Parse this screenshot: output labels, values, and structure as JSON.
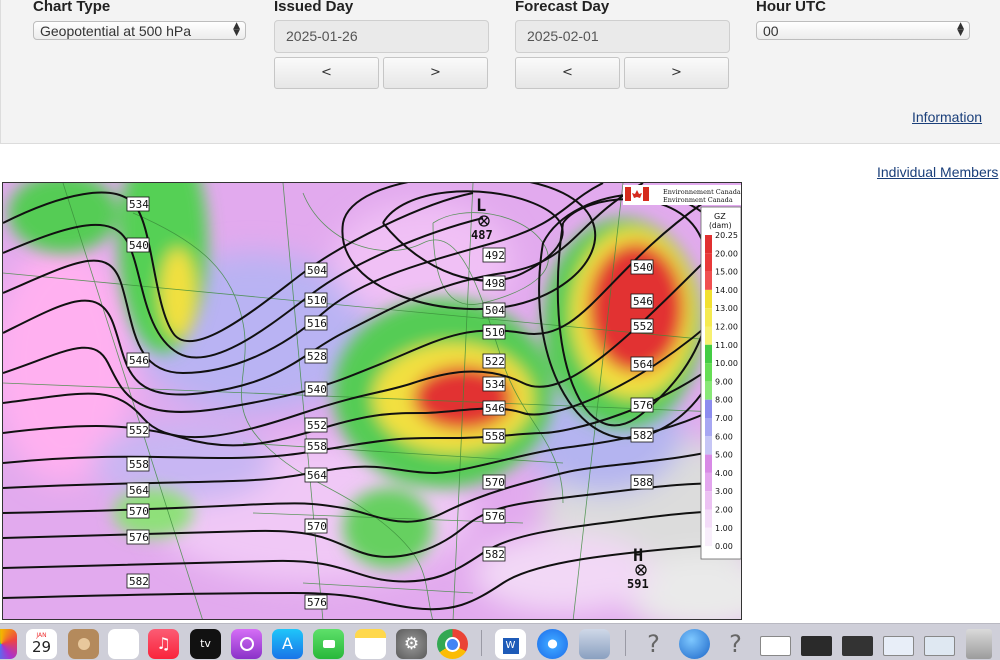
{
  "controls": {
    "chart_type_label": "Chart Type",
    "chart_type_value": "Geopotential at 500 hPa",
    "issued_day_label": "Issued Day",
    "issued_day_value": "2025-01-26",
    "forecast_day_label": "Forecast Day",
    "forecast_day_value": "2025-02-01",
    "hour_label": "Hour UTC",
    "hour_value": "00",
    "prev_label": "<",
    "next_label": ">",
    "information_link": "Information",
    "members_link": "Individual Members"
  },
  "map": {
    "logo_line1": "Environnement Canada",
    "logo_line2": "Environment Canada",
    "legend_title": "GZ",
    "legend_unit": "(dam)",
    "legend_values": [
      "20.25",
      "20.00",
      "15.00",
      "14.00",
      "13.00",
      "12.00",
      "11.00",
      "10.00",
      "9.00",
      "8.00",
      "7.00",
      "6.00",
      "5.00",
      "4.00",
      "3.00",
      "2.00",
      "1.00",
      "0.00"
    ],
    "legend_colors": [
      "#e03030",
      "#e83a3a",
      "#f05050",
      "#f2e030",
      "#f5ea50",
      "#f7f070",
      "#44cc44",
      "#66dd55",
      "#88e877",
      "#8c8cee",
      "#a7a7f2",
      "#c6c6f5",
      "#d88ae6",
      "#e3a6ee",
      "#ecc2f3",
      "#f3dcf8",
      "#f8eefb",
      "#ffffff"
    ],
    "low_letter": "L",
    "low_value": "487",
    "high_letter": "H",
    "high_value": "591",
    "contour_labels": [
      "534",
      "540",
      "546",
      "552",
      "558",
      "564",
      "570",
      "576",
      "582",
      "504",
      "510",
      "516",
      "528",
      "540",
      "552",
      "558",
      "564",
      "570",
      "576",
      "492",
      "498",
      "504",
      "510",
      "522",
      "534",
      "546",
      "558",
      "570",
      "576",
      "582",
      "540",
      "546",
      "552",
      "564",
      "576",
      "582",
      "588"
    ]
  },
  "dock": {
    "calendar_month": "JAN",
    "calendar_day": "29",
    "apps": [
      "contacts-app",
      "reminders-app",
      "music-app",
      "tv-app",
      "podcasts-app",
      "appstore-app",
      "facetime-app",
      "notes-app",
      "settings-app",
      "chrome-app",
      "word-app",
      "safari-app",
      "preview-app",
      "help-app",
      "globe-app",
      "help-app-2",
      "window-thumb-1",
      "window-thumb-2",
      "window-thumb-3",
      "window-thumb-4",
      "window-thumb-5",
      "trash-app"
    ],
    "tv_label": "tv"
  }
}
